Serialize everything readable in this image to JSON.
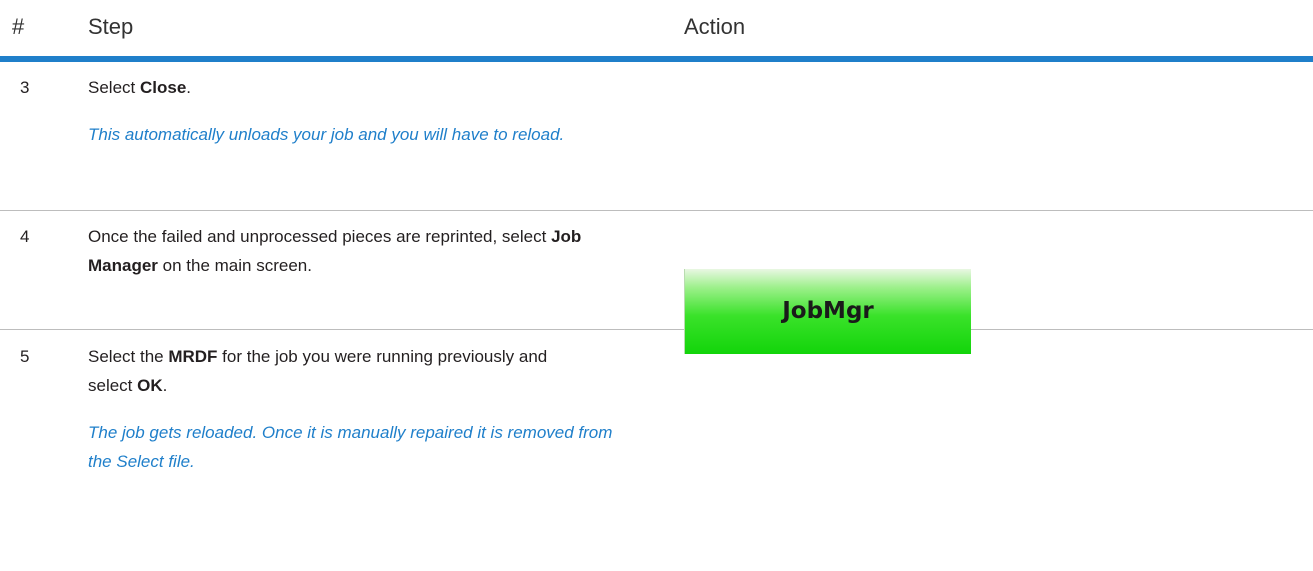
{
  "header": {
    "num": "#",
    "step": "Step",
    "action": "Action"
  },
  "rows": [
    {
      "num": "3",
      "step_prefix": "Select ",
      "step_bold": "Close",
      "step_suffix": ".",
      "note": " This automatically unloads your job and you will have to reload."
    },
    {
      "num": "4",
      "step_prefix": "Once the failed and unprocessed pieces are reprinted, select ",
      "step_bold": "Job Manager",
      "step_suffix": " on the main screen.",
      "action_button": {
        "label": "JobMgr",
        "color": "#22dc18"
      }
    },
    {
      "num": "5",
      "step_prefix": "Select the ",
      "step_bold": "MRDF",
      "step_middle": " for the job you were running previously and select ",
      "step_bold2": "OK",
      "step_suffix": ".",
      "note": "The job gets reloaded. Once it is manually repaired it is removed from the Select file."
    }
  ],
  "colors": {
    "accent": "#1f7fca",
    "divider": "#bdbdbd",
    "text": "#231f20"
  }
}
